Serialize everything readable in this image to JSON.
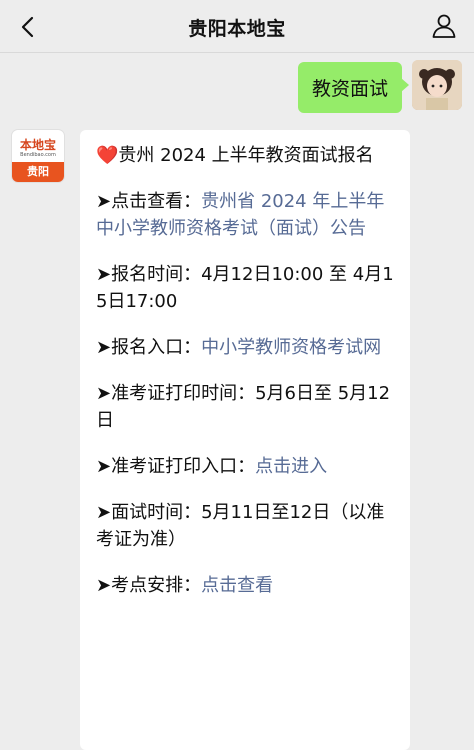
{
  "header": {
    "title": "贵阳本地宝",
    "back_icon": "chevron-left-icon",
    "profile_icon": "person-icon"
  },
  "outgoing_message": {
    "text": "教资面试"
  },
  "bot_avatar": {
    "logo_text": "本地宝",
    "logo_domain": "Bendibao.com",
    "city": "贵阳"
  },
  "incoming_message": {
    "heading_icon": "❤️",
    "heading": "贵州 2024 上半年教资面试报名",
    "items": [
      {
        "label": "➤点击查看：",
        "value": "",
        "link": "贵州省 2024 年上半年中小学教师资格考试（面试）公告"
      },
      {
        "label": "➤报名时间：",
        "value": "4月12日10:00 至 4月15日17:00",
        "link": ""
      },
      {
        "label": "➤报名入口：",
        "value": "",
        "link": "中小学教师资格考试网"
      },
      {
        "label": "➤准考证打印时间：",
        "value": "5月6日至 5月12日",
        "link": ""
      },
      {
        "label": "➤准考证打印入口：",
        "value": "",
        "link": "点击进入"
      },
      {
        "label": "➤面试时间：",
        "value": "5月11日至12日（以准考证为准）",
        "link": ""
      },
      {
        "label": "➤考点安排：",
        "value": "",
        "link": "点击查看"
      }
    ]
  },
  "colors": {
    "background": "#ededed",
    "outgoing_bubble": "#95ec69",
    "link": "#576b95",
    "brand": "#e8541f"
  }
}
